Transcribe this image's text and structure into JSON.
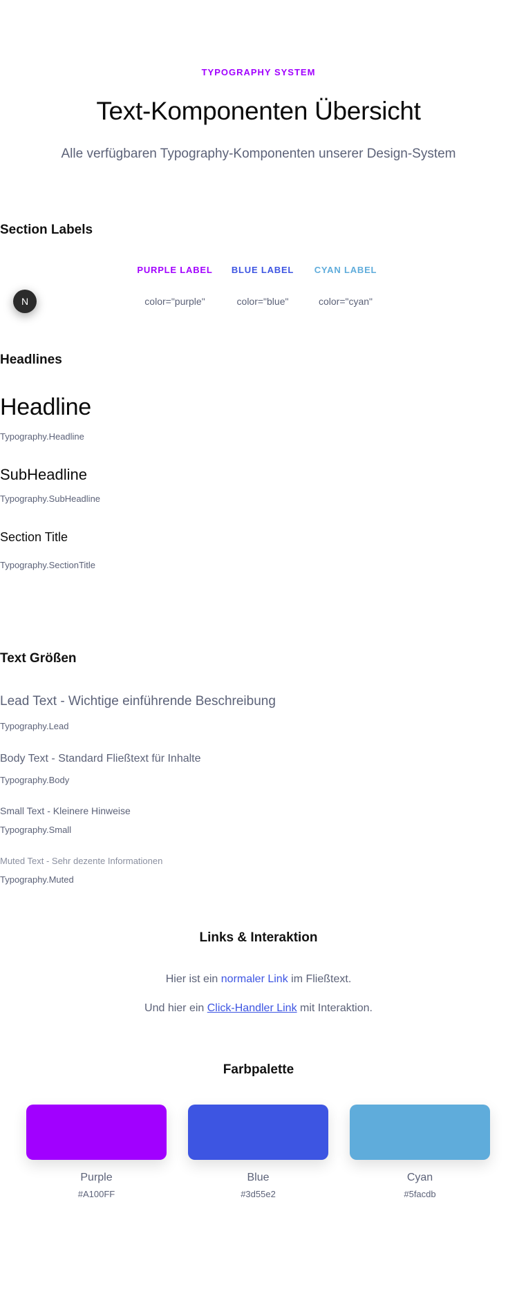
{
  "header": {
    "eyebrow": "TYPOGRAPHY SYSTEM",
    "title": "Text-Komponenten Übersicht",
    "subtitle": "Alle verfügbaren Typography-Komponenten unserer Design-System"
  },
  "section_labels": {
    "heading": "Section Labels",
    "items": [
      {
        "label": "PURPLE LABEL",
        "code": "color=\"purple\"",
        "color": "#A100FF"
      },
      {
        "label": "BLUE LABEL",
        "code": "color=\"blue\"",
        "color": "#3d55e2"
      },
      {
        "label": "CYAN LABEL",
        "code": "color=\"cyan\"",
        "color": "#5facdb"
      }
    ]
  },
  "badge": {
    "text": "N"
  },
  "headlines": {
    "heading": "Headlines",
    "items": [
      {
        "sample": "Headline",
        "component": "Typography.Headline"
      },
      {
        "sample": "SubHeadline",
        "component": "Typography.SubHeadline"
      },
      {
        "sample": "Section Title",
        "component": "Typography.SectionTitle"
      }
    ]
  },
  "text_sizes": {
    "heading": "Text Größen",
    "items": [
      {
        "sample": "Lead Text - Wichtige einführende Beschreibung",
        "component": "Typography.Lead"
      },
      {
        "sample": "Body Text - Standard Fließtext für Inhalte",
        "component": "Typography.Body"
      },
      {
        "sample": "Small Text - Kleinere Hinweise",
        "component": "Typography.Small"
      },
      {
        "sample": "Muted Text - Sehr dezente Informationen",
        "component": "Typography.Muted"
      }
    ]
  },
  "links": {
    "heading": "Links & Interaktion",
    "line1": {
      "before": "Hier ist ein ",
      "link": "normaler Link",
      "after": " im Fließtext."
    },
    "line2": {
      "before": "Und hier ein ",
      "link": "Click-Handler Link",
      "after": " mit Interaktion."
    }
  },
  "palette": {
    "heading": "Farbpalette",
    "colors": [
      {
        "name": "Purple",
        "hex": "#A100FF"
      },
      {
        "name": "Blue",
        "hex": "#3d55e2"
      },
      {
        "name": "Cyan",
        "hex": "#5facdb"
      }
    ]
  }
}
